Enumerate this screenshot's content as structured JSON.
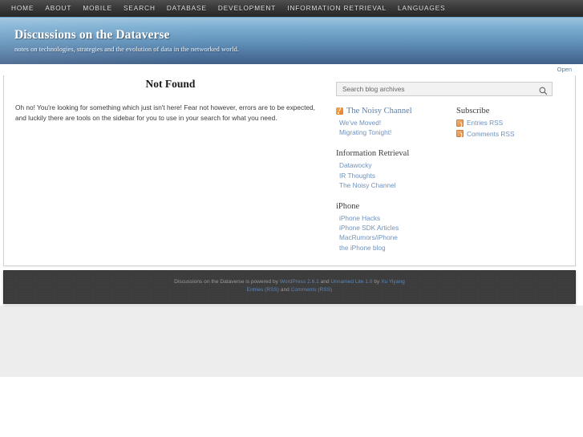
{
  "nav": {
    "items": [
      {
        "label": "HOME"
      },
      {
        "label": "ABOUT"
      },
      {
        "label": "MOBILE"
      },
      {
        "label": "SEARCH"
      },
      {
        "label": "DATABASE"
      },
      {
        "label": "DEVELOPMENT"
      },
      {
        "label": "INFORMATION RETRIEVAL"
      },
      {
        "label": "LANGUAGES"
      }
    ]
  },
  "header": {
    "title": "Discussions on the Dataverse",
    "tagline": "notes on technologies, strategies and the evolution of data in the networked world.",
    "open_label": "Open"
  },
  "main": {
    "title": "Not Found",
    "body": "Oh no! You're looking for something which just isn't here! Fear not however, errors are to be expected, and luckily there are tools on the sidebar for you to use in your search for what you need."
  },
  "sidebar": {
    "search": {
      "placeholder": "Search blog archives",
      "value": "",
      "icon": "search-icon"
    },
    "groups": [
      {
        "heading": "The Noisy Channel",
        "heading_is_link": true,
        "heading_icon": "rss-icon",
        "links": [
          {
            "label": "We've Moved!"
          },
          {
            "label": "Migrating Tonight!"
          }
        ]
      },
      {
        "heading": "Information Retrieval",
        "heading_is_link": false,
        "links": [
          {
            "label": "Datawocky"
          },
          {
            "label": "IR Thoughts"
          },
          {
            "label": "The Noisy Channel"
          }
        ]
      },
      {
        "heading": "iPhone",
        "heading_is_link": false,
        "links": [
          {
            "label": "iPhone Hacks"
          },
          {
            "label": "iPhone SDK Articles"
          },
          {
            "label": "MacRumors/iPhone"
          },
          {
            "label": "the iPhone blog"
          }
        ]
      }
    ],
    "subscribe": {
      "heading": "Subscribe",
      "feeds": [
        {
          "label": "Entries RSS",
          "icon": "feed-icon"
        },
        {
          "label": "Comments RSS",
          "icon": "feed-icon"
        }
      ]
    }
  },
  "footer": {
    "line1_pre": "Discussions on the Dataverse is powered by ",
    "line1_link1": "WordPress 2.6.1",
    "line1_mid": " and ",
    "line1_link2": "Unnamed Lite 1.0",
    "line1_post": " by ",
    "line1_link3": "Xu Yiyang",
    "line2_link1": "Entries (RSS)",
    "line2_mid": " and ",
    "line2_link2": "Comments (RSS)"
  },
  "colors": {
    "nav_bg": "#3c3c3c",
    "banner_top": "#9cc3dd",
    "banner_bottom": "#3f5f86",
    "link": "#6f92bd",
    "rss_orange": "#e8792a",
    "footer_bg": "#3c3c3c"
  }
}
